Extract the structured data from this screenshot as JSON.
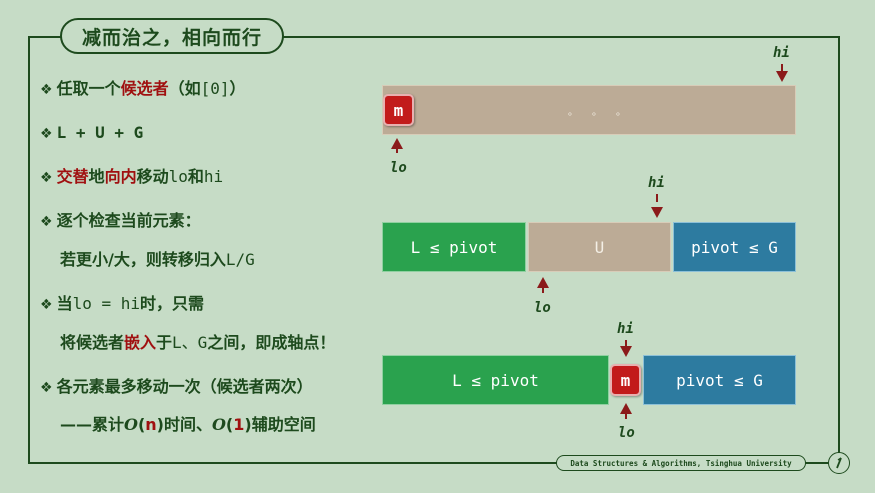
{
  "title": "减而治之，相向而行",
  "bullets": {
    "b1_pre": "任取一个",
    "b1_red": "候选者",
    "b1_post": "（如",
    "b1_code": "[0]",
    "b1_end": "）",
    "b2": "L + U + G",
    "b3_red1": "交替",
    "b3_mid1": "地",
    "b3_red2": "向内",
    "b3_mid2": "移动",
    "b3_lo": "lo",
    "b3_and": "和",
    "b3_hi": "hi",
    "b4": "逐个检查当前元素：",
    "b4_sub_pre": "若更小/大，则转移归入",
    "b4_sub_code": "L/G",
    "b5_pre": "当",
    "b5_code": "lo = hi",
    "b5_post": "时，只需",
    "b5_sub_pre": "将候选者",
    "b5_sub_red": "嵌入",
    "b5_sub_mid": "于",
    "b5_sub_code": "L、G",
    "b5_sub_post": "之间，即成轴点！",
    "b6": "各元素最多移动一次（候选者两次）",
    "b6_sub_pre": "——累计",
    "b6_o1": "O",
    "b6_n_open": "(",
    "b6_n": "n",
    "b6_n_close": ")",
    "b6_mid": "时间、",
    "b6_o2": "O",
    "b6_one_open": "(",
    "b6_one": "1",
    "b6_one_close": ")",
    "b6_post": "辅助空间"
  },
  "diagram": {
    "row1": {
      "m": "m",
      "dots": "。 。 。",
      "hi": "hi",
      "lo": "lo"
    },
    "row2": {
      "L": "L ≤ pivot",
      "U": "U",
      "G": "pivot ≤ G",
      "hi": "hi",
      "lo": "lo"
    },
    "row3": {
      "L": "L ≤ pivot",
      "m": "m",
      "G": "pivot ≤ G",
      "hi": "hi",
      "lo": "lo"
    }
  },
  "footer": {
    "text": "Data Structures & Algorithms, Tsinghua University",
    "page_icon": "page-number-icon"
  },
  "colors": {
    "background": "#c6dcc6",
    "frame": "#1d4a1d",
    "accent_red": "#a01010",
    "pivot": "#c21b1b",
    "L_green": "#2aa24e",
    "G_blue": "#2d7ba0",
    "U_tan": "#bcab96",
    "arrow": "#8b1a1a"
  }
}
